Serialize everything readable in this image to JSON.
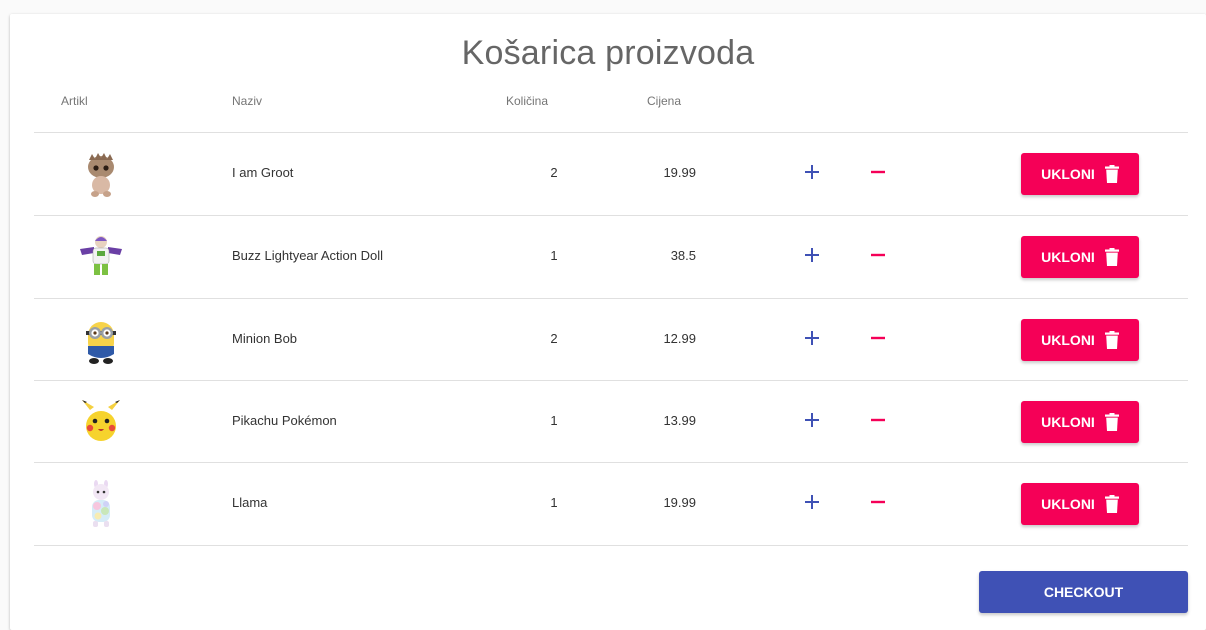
{
  "cart": {
    "title": "Košarica proizvoda",
    "columns": {
      "artikl": "Artikl",
      "naziv": "Naziv",
      "kolicina": "Količina",
      "cijena": "Cijena"
    },
    "remove_label": "UKLONI",
    "checkout_label": "CHECKOUT",
    "items": [
      {
        "name": "I am Groot",
        "quantity": "2",
        "price": "19.99",
        "image_icon": "groot-toy-icon"
      },
      {
        "name": "Buzz Lightyear Action Doll",
        "quantity": "1",
        "price": "38.5",
        "image_icon": "buzz-lightyear-toy-icon"
      },
      {
        "name": "Minion Bob",
        "quantity": "2",
        "price": "12.99",
        "image_icon": "minion-toy-icon"
      },
      {
        "name": "Pikachu Pokémon",
        "quantity": "1",
        "price": "13.99",
        "image_icon": "pikachu-toy-icon"
      },
      {
        "name": "Llama",
        "quantity": "1",
        "price": "19.99",
        "image_icon": "llama-toy-icon"
      }
    ]
  },
  "colors": {
    "accent_pink": "#f50057",
    "primary_indigo": "#3f51b5",
    "plus_icon": "#3f51b5",
    "minus_icon": "#f50057"
  }
}
